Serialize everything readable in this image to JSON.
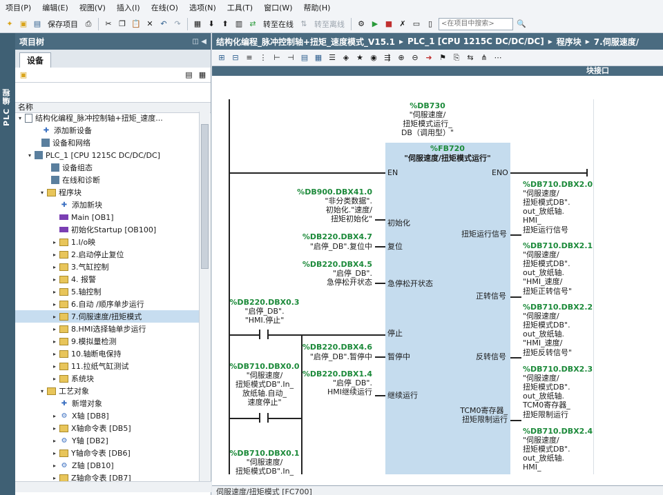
{
  "menu": [
    "项目(P)",
    "编辑(E)",
    "视图(V)",
    "插入(I)",
    "在线(O)",
    "选项(N)",
    "工具(T)",
    "窗口(W)",
    "帮助(H)"
  ],
  "toolbar": {
    "save_project": "保存项目",
    "go_online": "转至在线",
    "go_offline": "转至离线",
    "search_placeholder": "<在项目中搜索>"
  },
  "side_tab": "PLC 编程",
  "tree": {
    "title": "项目树",
    "device_tab": "设备",
    "name_column": "名称",
    "items": [
      {
        "label": "结构化编程_脉冲控制轴+扭矩_速度...",
        "arrow": "▾",
        "icon": "doc"
      },
      {
        "label": "添加新设备",
        "arrow": "",
        "icon": "add"
      },
      {
        "label": "设备和网络",
        "arrow": "",
        "icon": "dev"
      },
      {
        "label": "PLC_1 [CPU 1215C DC/DC/DC]",
        "arrow": "▾",
        "icon": "dev"
      },
      {
        "label": "设备组态",
        "arrow": "",
        "icon": "dev"
      },
      {
        "label": "在线和诊断",
        "arrow": "",
        "icon": "dev"
      },
      {
        "label": "程序块",
        "arrow": "▾",
        "icon": "folder"
      },
      {
        "label": "添加新块",
        "arrow": "",
        "icon": "add"
      },
      {
        "label": "Main [OB1]",
        "arrow": "",
        "icon": "block"
      },
      {
        "label": "初始化Startup [OB100]",
        "arrow": "",
        "icon": "block"
      },
      {
        "label": "1.I/o映",
        "arrow": "▸",
        "icon": "folder"
      },
      {
        "label": "2.启动停止复位",
        "arrow": "▸",
        "icon": "folder"
      },
      {
        "label": "3.气缸控制",
        "arrow": "▸",
        "icon": "folder"
      },
      {
        "label": "4. 报警",
        "arrow": "▸",
        "icon": "folder"
      },
      {
        "label": "5.轴控制",
        "arrow": "▸",
        "icon": "folder"
      },
      {
        "label": "6.自动 /顺序单步运行",
        "arrow": "▸",
        "icon": "folder"
      },
      {
        "label": "7.伺服速度/扭矩模式",
        "arrow": "▸",
        "icon": "folder"
      },
      {
        "label": "8.HMI选择轴单步运行",
        "arrow": "▸",
        "icon": "folder"
      },
      {
        "label": "9.模拟量检测",
        "arrow": "▸",
        "icon": "folder"
      },
      {
        "label": "10.轴断电保持",
        "arrow": "▸",
        "icon": "folder"
      },
      {
        "label": "11.拉纸气缸测试",
        "arrow": "▸",
        "icon": "folder"
      },
      {
        "label": "系统块",
        "arrow": "▸",
        "icon": "folder"
      },
      {
        "label": "工艺对象",
        "arrow": "▾",
        "icon": "folder"
      },
      {
        "label": "新增对象",
        "arrow": "",
        "icon": "add"
      },
      {
        "label": "X轴 [DB8]",
        "arrow": "▸",
        "icon": "axis"
      },
      {
        "label": "X轴命令表 [DB5]",
        "arrow": "▸",
        "icon": "folder"
      },
      {
        "label": "Y轴 [DB2]",
        "arrow": "▸",
        "icon": "axis"
      },
      {
        "label": "Y轴命令表 [DB6]",
        "arrow": "▸",
        "icon": "folder"
      },
      {
        "label": "Z轴 [DB10]",
        "arrow": "▸",
        "icon": "axis"
      },
      {
        "label": "Z轴命令表 [DB7]",
        "arrow": "▸",
        "icon": "folder"
      }
    ],
    "selected_index": 16
  },
  "breadcrumb": [
    "结构化编程_脉冲控制轴+扭矩_速度模式_V15.1",
    "PLC_1 [CPU 1215C DC/DC/DC]",
    "程序块",
    "7.伺服速度/"
  ],
  "interface_label": "块接口",
  "bottom_tab": "伺服速度/扭矩模式 [FC700]",
  "ladder": {
    "instance_db": {
      "addr": "%DB730",
      "lines": [
        "\"伺服速度/",
        "扭矩模式运行_",
        "DB（调用型）\""
      ]
    },
    "fb": {
      "addr": "%FB720",
      "name": "\"伺服速度/扭矩模式运行\"",
      "en": "EN",
      "eno": "ENO"
    },
    "inputs": [
      {
        "addr": "%DB900.DBX41.0",
        "lines": [
          "\"非分类数据\".",
          "初始化.\"速度/",
          "扭矩初始化\""
        ],
        "pin": "初始化"
      },
      {
        "addr": "%DB220.DBX4.7",
        "lines": [
          "\"启停_DB\".复位中"
        ],
        "pin": "复位"
      },
      {
        "addr": "%DB220.DBX4.5",
        "lines": [
          "\"启停_DB\".",
          "急停松开状态"
        ],
        "pin": "急停松开状态"
      },
      {
        "addr": "",
        "lines": [],
        "pin": "停止"
      },
      {
        "addr": "%DB220.DBX4.6",
        "lines": [
          "\"启停_DB\".暂停中"
        ],
        "pin": "暂停中"
      },
      {
        "addr": "%DB220.DBX1.4",
        "lines": [
          "\"启停_DB\".",
          "HMI继续运行"
        ],
        "pin": "继续运行"
      }
    ],
    "contacts": [
      {
        "addr": "%DB220.DBX0.3",
        "lines": [
          "\"启停_DB\".",
          "\"HMI.停止\""
        ]
      },
      {
        "addr": "%DB710.DBX0.0",
        "lines": [
          "\"伺服速度/",
          "扭矩模式DB\".In_",
          "放纸轴.自动_",
          "速度停止\""
        ]
      },
      {
        "addr": "%DB710.DBX0.1",
        "lines": [
          "\"伺服速度/",
          "扭矩模式DB\".In_"
        ]
      }
    ],
    "outputs": [
      {
        "pin": "扭矩运行信号",
        "addr": "%DB710.DBX2.0",
        "lines": [
          "\"伺服速度/",
          "扭矩模式DB\".",
          "out_放纸轴.",
          "HMI_",
          "扭矩运行信号"
        ]
      },
      {
        "pin": "正转信号",
        "addr": "%DB710.DBX2.1",
        "lines": [
          "\"伺服速度/",
          "扭矩模式DB\".",
          "out_放纸轴.",
          "\"HMI_速度/",
          "扭矩正转信号\""
        ]
      },
      {
        "pin": "反转信号",
        "addr": "%DB710.DBX2.2",
        "lines": [
          "\"伺服速度/",
          "扭矩模式DB\".",
          "out_放纸轴.",
          "\"HMI_速度/",
          "扭矩反转信号\""
        ]
      },
      {
        "pin": "TCM0寄存器_扭矩限制运行",
        "pin_lines": [
          "TCM0寄存器_",
          "扭矩限制运行"
        ],
        "addr": "%DB710.DBX2.3",
        "lines": [
          "\"伺服速度/",
          "扭矩模式DB\".",
          "out_放纸轴.",
          "TCM0寄存器_",
          "扭矩限制运行"
        ]
      },
      {
        "pin": "",
        "addr": "%DB710.DBX2.4",
        "lines": [
          "\"伺服速度/",
          "扭矩模式DB\".",
          "out_放纸轴.",
          "HMI_"
        ]
      }
    ]
  }
}
